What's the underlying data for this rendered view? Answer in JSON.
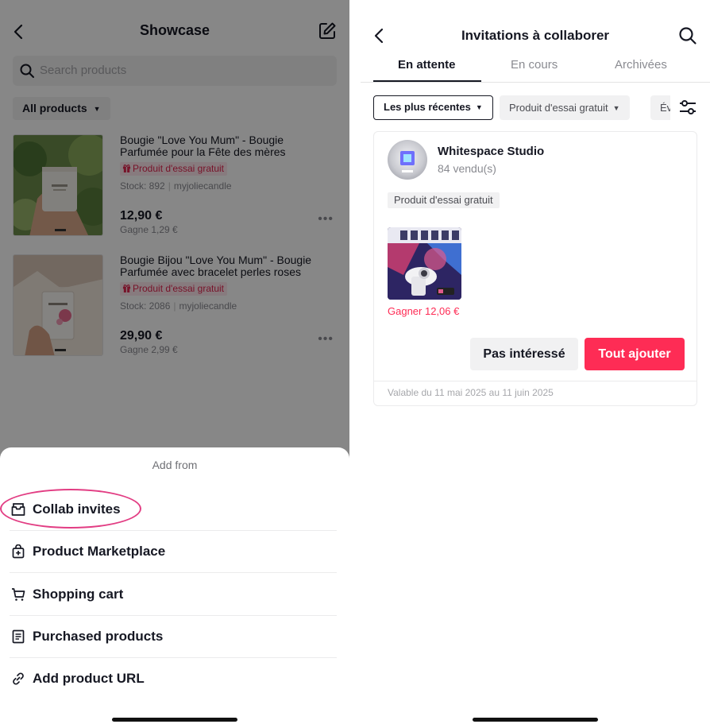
{
  "left": {
    "header": {
      "title": "Showcase"
    },
    "search": {
      "placeholder": "Search products"
    },
    "filter": {
      "label": "All products"
    },
    "products": [
      {
        "name": "Bougie \"Love You Mum\" - Bougie Parfumée pour la Fête des mères",
        "tag": "Produit d'essai gratuit",
        "stock": "Stock: 892",
        "seller": "myjoliecandle",
        "price": "12,90 €",
        "earn": "Gagne 1,29 €"
      },
      {
        "name": "Bougie Bijou \"Love You Mum\" - Bougie Parfumée avec bracelet perles roses",
        "tag": "Produit d'essai gratuit",
        "stock": "Stock: 2086",
        "seller": "myjoliecandle",
        "price": "29,90 €",
        "earn": "Gagne 2,99 €"
      }
    ],
    "sheet": {
      "title": "Add from",
      "items": [
        {
          "label": "Collab invites",
          "icon": "inbox-icon"
        },
        {
          "label": "Product Marketplace",
          "icon": "shopping-bag-plus-icon"
        },
        {
          "label": "Shopping cart",
          "icon": "cart-icon"
        },
        {
          "label": "Purchased products",
          "icon": "receipt-icon"
        },
        {
          "label": "Add product URL",
          "icon": "link-icon"
        }
      ]
    },
    "highlight_color": "#e23d83"
  },
  "right": {
    "header": {
      "title": "Invitations à collaborer"
    },
    "tabs": [
      {
        "label": "En attente",
        "active": true
      },
      {
        "label": "En cours",
        "active": false
      },
      {
        "label": "Archivées",
        "active": false
      }
    ],
    "chips": [
      {
        "label": "Les plus récentes",
        "selected": true
      },
      {
        "label": "Produit d'essai gratuit",
        "selected": false
      },
      {
        "label": "Év",
        "selected": false
      }
    ],
    "invite": {
      "shop_name": "Whitespace Studio",
      "sold": "84 vendu(s)",
      "badge": "Produit d'essai gratuit",
      "earn": "Gagner 12,06 €",
      "decline_label": "Pas intéressé",
      "accept_label": "Tout ajouter",
      "validity": "Valable du 11 mai 2025 au 11 juin 2025"
    },
    "accent_color": "#fe2c55"
  }
}
